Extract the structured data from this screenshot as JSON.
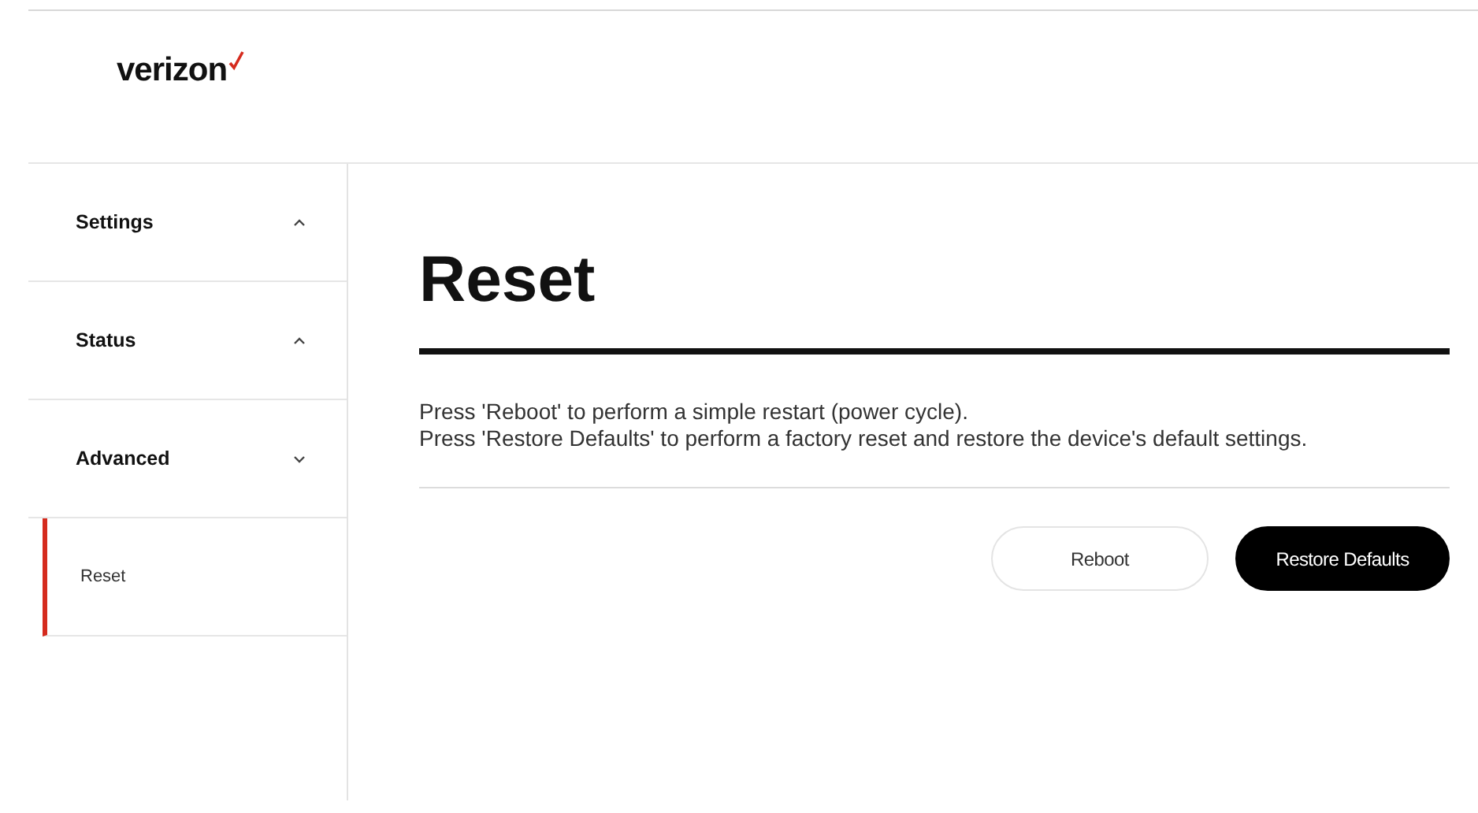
{
  "header": {
    "logo": "verizon"
  },
  "sidebar": {
    "items": [
      {
        "label": "Settings",
        "expanded": false
      },
      {
        "label": "Status",
        "expanded": false
      },
      {
        "label": "Advanced",
        "expanded": true,
        "children": [
          {
            "label": "Reset",
            "selected": true
          }
        ]
      }
    ]
  },
  "main": {
    "title": "Reset",
    "description": [
      "Press 'Reboot' to perform a simple restart (power cycle).",
      "Press 'Restore Defaults' to perform a factory reset and restore the device's default settings."
    ],
    "buttons": [
      {
        "label": "Reboot",
        "kind": "secondary"
      },
      {
        "label": "Restore Defaults",
        "kind": "primary"
      }
    ]
  }
}
